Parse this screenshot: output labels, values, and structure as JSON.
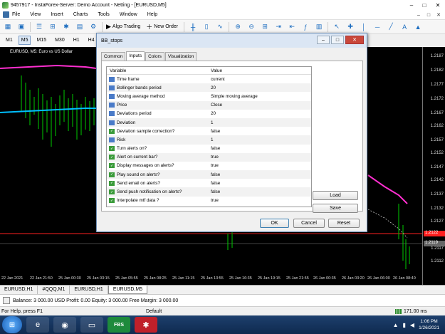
{
  "window": {
    "title": "9457917 - InstaForex-Server: Demo Account - Netting - [EURUSD,M5]",
    "controls": [
      "–",
      "□",
      "✕"
    ]
  },
  "menu": {
    "items": [
      "File",
      "View",
      "Insert",
      "Charts",
      "Tools",
      "Window",
      "Help"
    ],
    "right_controls": [
      "–",
      "□",
      "✕"
    ]
  },
  "toolbar": {
    "algo_trading": "Algo Trading",
    "new_order": "New Order"
  },
  "timeframes": {
    "items": [
      "M1",
      "M5",
      "M15",
      "M30",
      "H1",
      "H4"
    ],
    "active": "M5"
  },
  "chart": {
    "title": "EURUSD, M5:  Euro vs US Dollar",
    "price_labels": [
      "1.2187",
      "1.2182",
      "1.2177",
      "1.2172",
      "1.2167",
      "1.2162",
      "1.2157",
      "1.2152",
      "1.2147",
      "1.2142",
      "1.2137",
      "1.2132",
      "1.2127",
      "1.2122",
      "1.2117",
      "1.2112"
    ],
    "price_tag_red": "1.2122",
    "price_tag_grey": "1.2119",
    "time_labels": [
      "22 Jan 2021",
      "22 Jan 21:50",
      "25 Jan 00:30",
      "25 Jan 03:15",
      "25 Jan 05:55",
      "25 Jan 08:25",
      "25 Jan 11:15",
      "25 Jan 13:55",
      "25 Jan 16:35",
      "25 Jan 19:15",
      "25 Jan 21:55",
      "26 Jan 00:35",
      "26 Jan 03:20",
      "26 Jan 06:00",
      "26 Jan 08:40"
    ],
    "colors": {
      "upper_band": "#ff2fd0",
      "lower_band": "#00bfff",
      "candles": "#00cc00",
      "red_line": "#ff2020"
    }
  },
  "chart_tabs": {
    "items": [
      "EURUSD,H1",
      "#QQQ,M1",
      "EURUSD,H1",
      "EURUSD,M5"
    ],
    "active_index": 3
  },
  "terminal": {
    "text": "Balance: 3 000.00 USD  Profit: 0.00  Equity: 3 000.00  Free Margin: 3 000.00"
  },
  "status": {
    "help": "For Help, press F1",
    "profile": "Default",
    "connection": "171.00 ms"
  },
  "taskbar": {
    "apps": [
      "ie",
      "chrome",
      "explorer",
      "FBS",
      "instaforex"
    ],
    "fbs_label": "FBS",
    "time": "1:06 PM",
    "date": "1/26/2021"
  },
  "dialog": {
    "title": "BB_stops",
    "tabs": [
      "Common",
      "Inputs",
      "Colors",
      "Visualization"
    ],
    "active_tab": "Inputs",
    "columns": [
      "Variable",
      "Value"
    ],
    "rows": [
      {
        "icon": "123",
        "variable": "Time frame",
        "value": "current"
      },
      {
        "icon": "123",
        "variable": "Bollinger bands period",
        "value": "20"
      },
      {
        "icon": "123",
        "variable": "Moving average method",
        "value": "Simple moving average"
      },
      {
        "icon": "123",
        "variable": "Price",
        "value": "Close"
      },
      {
        "icon": "123",
        "variable": "Deviations period",
        "value": "20"
      },
      {
        "icon": "1/2",
        "variable": "Deviation",
        "value": "1"
      },
      {
        "icon": "bool",
        "variable": "Deviation sample correction?",
        "value": "false"
      },
      {
        "icon": "1/2",
        "variable": "Risk",
        "value": "1"
      },
      {
        "icon": "bool",
        "variable": "Turn alerts on?",
        "value": "false"
      },
      {
        "icon": "bool",
        "variable": "Alert on current bar?",
        "value": "true"
      },
      {
        "icon": "bool",
        "variable": "Display messages on alerts?",
        "value": "true"
      },
      {
        "icon": "bool",
        "variable": "Play sound on alerts?",
        "value": "false"
      },
      {
        "icon": "bool",
        "variable": "Send email on alerts?",
        "value": "false"
      },
      {
        "icon": "bool",
        "variable": "Send push notification on alerts?",
        "value": "false"
      },
      {
        "icon": "bool",
        "variable": "Interpolate mtf data ?",
        "value": "true"
      }
    ],
    "load": "Load",
    "save": "Save",
    "ok": "OK",
    "cancel": "Cancel",
    "reset": "Reset",
    "title_controls": [
      "–",
      "□",
      "✕"
    ]
  }
}
